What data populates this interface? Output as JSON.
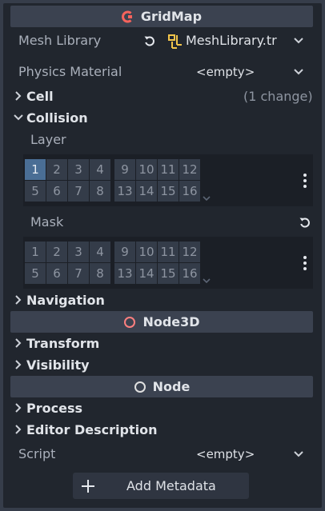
{
  "gridmap_header": {
    "title": "GridMap",
    "icon": "gridmap-icon",
    "icon_color": "#f7635c"
  },
  "mesh_library": {
    "label": "Mesh Library",
    "value": "MeshLibrary.tr",
    "icon": "mesh-library-icon",
    "icon_color": "#f3c54b"
  },
  "physics_material": {
    "label": "Physics Material",
    "value": "<empty>"
  },
  "cell_section": {
    "label": "Cell",
    "note": "(1 change)"
  },
  "collision_section": {
    "label": "Collision"
  },
  "layer": {
    "label": "Layer",
    "bits_row1": [
      "1",
      "2",
      "3",
      "4",
      "9",
      "10",
      "11",
      "12"
    ],
    "bits_row2": [
      "5",
      "6",
      "7",
      "8",
      "13",
      "14",
      "15",
      "16"
    ],
    "active": [
      "1"
    ]
  },
  "mask": {
    "label": "Mask",
    "bits_row1": [
      "1",
      "2",
      "3",
      "4",
      "9",
      "10",
      "11",
      "12"
    ],
    "bits_row2": [
      "5",
      "6",
      "7",
      "8",
      "13",
      "14",
      "15",
      "16"
    ],
    "active": []
  },
  "navigation_section": {
    "label": "Navigation"
  },
  "node3d_header": {
    "title": "Node3D",
    "icon": "node3d-icon",
    "icon_color": "#fc7f7f"
  },
  "transform_section": {
    "label": "Transform"
  },
  "visibility_section": {
    "label": "Visibility"
  },
  "node_header": {
    "title": "Node",
    "icon": "node-icon",
    "icon_color": "#e0e0e0"
  },
  "process_section": {
    "label": "Process"
  },
  "editor_description_section": {
    "label": "Editor Description"
  },
  "script": {
    "label": "Script",
    "value": "<empty>"
  },
  "add_metadata": {
    "label": "Add Metadata"
  },
  "colors": {
    "panel_bg": "#21262e",
    "header_bg": "#3b4250",
    "bit_active": "#4a6e95",
    "bit_inactive": "#343c49"
  }
}
